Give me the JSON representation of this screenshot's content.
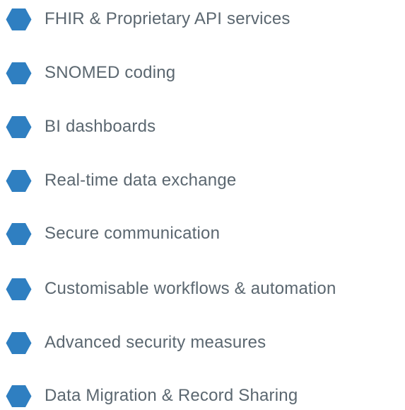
{
  "colors": {
    "icon_fill": "#2f7fc1",
    "text": "#5b6770"
  },
  "features": [
    {
      "label": "FHIR & Proprietary API services",
      "icon": "hexagon-bullet-icon"
    },
    {
      "label": "SNOMED coding",
      "icon": "hexagon-bullet-icon"
    },
    {
      "label": "BI dashboards",
      "icon": "hexagon-bullet-icon"
    },
    {
      "label": "Real-time data exchange",
      "icon": "hexagon-bullet-icon"
    },
    {
      "label": "Secure communication",
      "icon": "hexagon-bullet-icon"
    },
    {
      "label": "Customisable workflows & automation",
      "icon": "hexagon-bullet-icon"
    },
    {
      "label": "Advanced security measures",
      "icon": "hexagon-bullet-icon"
    },
    {
      "label": "Data Migration & Record Sharing",
      "icon": "hexagon-bullet-icon"
    }
  ]
}
